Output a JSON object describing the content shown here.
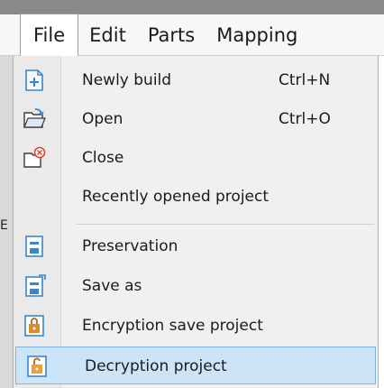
{
  "menubar": {
    "tabs": [
      {
        "label": "File",
        "active": true
      },
      {
        "label": "Edit",
        "active": false
      },
      {
        "label": "Parts",
        "active": false
      },
      {
        "label": "Mapping",
        "active": false
      }
    ]
  },
  "left_edge": {
    "letter": "E"
  },
  "file_menu": {
    "items": [
      {
        "label": "Newly build",
        "shortcut": "Ctrl+N",
        "icon": "new-file-icon"
      },
      {
        "label": "Open",
        "shortcut": "Ctrl+O",
        "icon": "open-folder-icon"
      },
      {
        "label": "Close",
        "shortcut": "",
        "icon": "close-folder-icon"
      },
      {
        "label": "Recently opened project",
        "shortcut": "",
        "icon": ""
      },
      {
        "label": "Preservation",
        "shortcut": "",
        "icon": "save-icon"
      },
      {
        "label": "Save as",
        "shortcut": "",
        "icon": "save-as-icon"
      },
      {
        "label": "Encryption save project",
        "shortcut": "",
        "icon": "encrypt-save-icon"
      },
      {
        "label": "Decryption project",
        "shortcut": "",
        "icon": "decrypt-project-icon",
        "highlighted": true
      }
    ]
  },
  "colors": {
    "highlight_bg": "#cce4f7",
    "highlight_border": "#7fb3e0",
    "menu_bg": "#f0f0f0",
    "icon_blue": "#3a86c8",
    "icon_orange": "#d98a2b"
  }
}
